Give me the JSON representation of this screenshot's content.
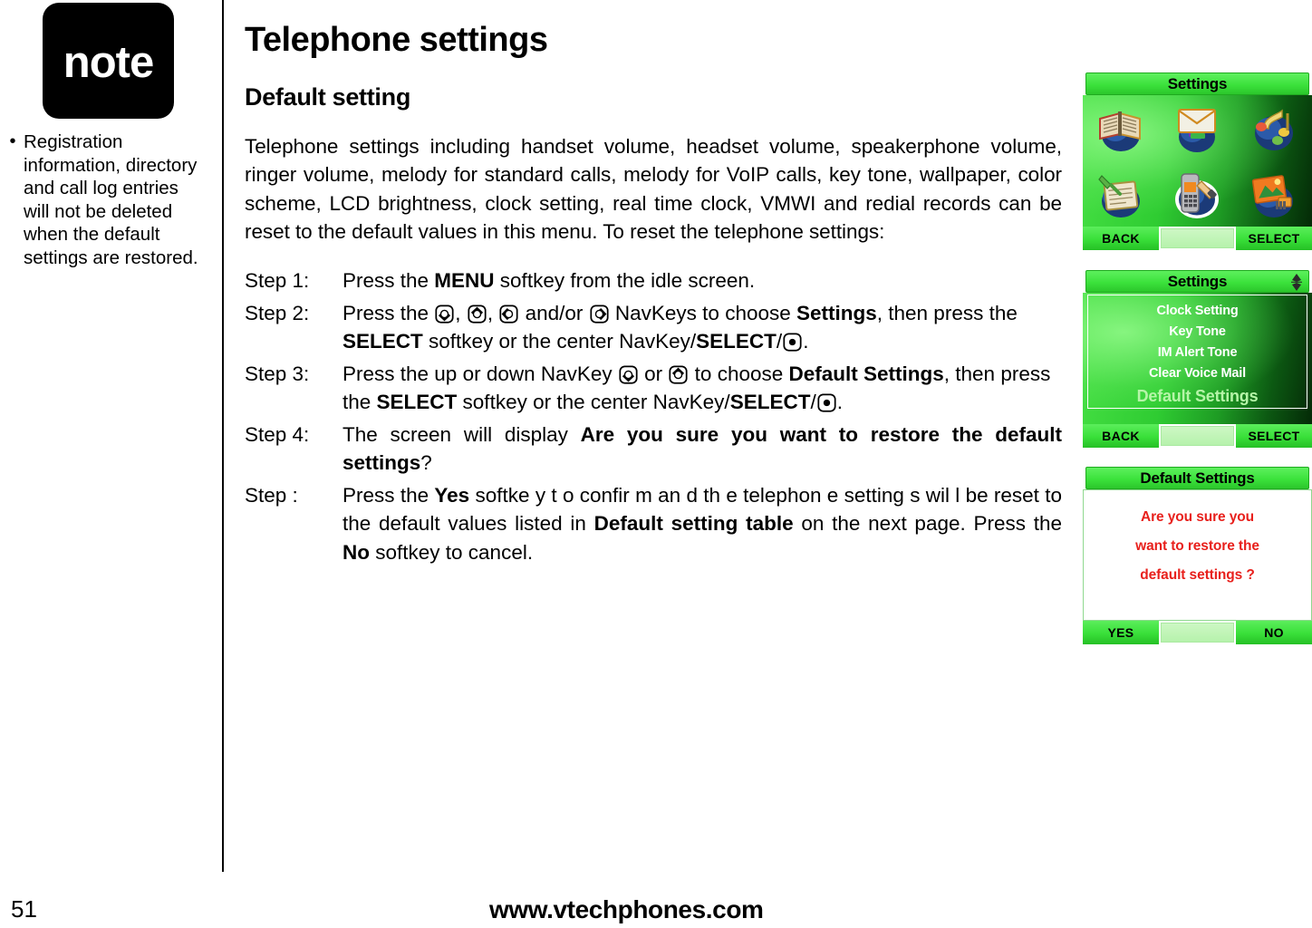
{
  "note": {
    "badge_label": "note",
    "items": [
      {
        "bullet": "•",
        "text": "Registration information, directory and call log entries will not be deleted when the default settings are restored."
      }
    ]
  },
  "main": {
    "page_title": "Telephone settings",
    "section_title": "Default setting",
    "intro_paragraph": "Telephone settings including handset volume, headset volume, speakerphone volume, ringer volume, melody for standard calls, melody for VoIP calls, key tone, wallpaper, color scheme, LCD brightness, clock setting, real time clock, VMWI and redial records can be reset to the default values in this menu. To reset the telephone settings:",
    "steps": [
      {
        "label": "Step 1:"
      },
      {
        "label": "Step 2:"
      },
      {
        "label": "Step 3:"
      },
      {
        "label": "Step 4:"
      },
      {
        "label": "Step :"
      }
    ],
    "step1": {
      "part1": "Press the ",
      "bold1": "MENU",
      "part2": " softkey from the idle screen."
    },
    "step2": {
      "part1": "Press the ",
      "sep1": ", ",
      "sep2": ", ",
      "andor": " and/or ",
      "part2": " NavKeys to choose ",
      "bold1": "Settings",
      "part3": ", then press the ",
      "bold2": "SELECT",
      "part4": " softkey or the center NavKey/",
      "bold3": "SELECT",
      "part5": "/",
      "part6": "."
    },
    "step3": {
      "part1": "Press the up or down NavKey ",
      "or": " or ",
      "part2": " to choose ",
      "bold1": "Default Settings",
      "part3": ", then press the ",
      "bold2": "SELECT",
      "part4": " softkey or the center NavKey/",
      "bold3": "SELECT",
      "part5": "/",
      "part6": "."
    },
    "step4": {
      "part1": "The screen will display ",
      "bold1": "Are you sure you want to restore the default settings",
      "part2": "?"
    },
    "step5": {
      "part1": "Press the ",
      "bold1": "Yes",
      "part2": " softke y t o confir m an d th e telephon e setting s wil l be reset to the default values listed in ",
      "bold2": "Default setting table",
      "part3": " on the next page. Press the ",
      "bold3": "No",
      "part4": " softkey to cancel."
    }
  },
  "screens": {
    "settings_grid": {
      "title": "Settings",
      "icons": [
        {
          "name": "directory-book-icon"
        },
        {
          "name": "message-envelope-icon"
        },
        {
          "name": "music-notes-icon"
        },
        {
          "name": "notepad-pen-icon"
        },
        {
          "name": "phone-settings-icon",
          "selected": true
        },
        {
          "name": "picture-gallery-icon"
        }
      ],
      "softkey_left": "BACK",
      "softkey_right": "SELECT"
    },
    "settings_list": {
      "title": "Settings",
      "scroll_indicator": "up-down-arrow-icon",
      "items": [
        {
          "label": "Clock Setting",
          "selected": false
        },
        {
          "label": "Key Tone",
          "selected": false
        },
        {
          "label": "IM Alert Tone",
          "selected": false
        },
        {
          "label": "Clear Voice Mail",
          "selected": false
        },
        {
          "label": "Default Settings",
          "selected": true
        }
      ],
      "softkey_left": "BACK",
      "softkey_right": "SELECT"
    },
    "default_confirm": {
      "title": "Default Settings",
      "message_lines": [
        "Are you sure you",
        "want to restore the",
        "default settings ?"
      ],
      "softkey_left": "YES",
      "softkey_right": "NO"
    }
  },
  "footer": {
    "page_number": "51",
    "website": "www.vtechphones.com"
  },
  "colors": {
    "screen_green_bright": "#3ce23c",
    "screen_green_dark": "#042a07",
    "confirm_red": "#e8201c",
    "selected_menu": "#b6f5a8"
  }
}
